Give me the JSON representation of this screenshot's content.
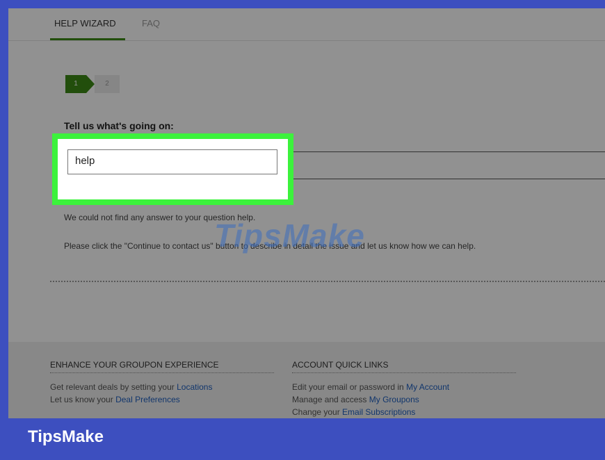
{
  "tabs": {
    "help_wizard": "HELP WIZARD",
    "faq": "FAQ"
  },
  "steps": {
    "step1": "1",
    "step2": "2"
  },
  "form": {
    "question_label": "Tell us what's going on:",
    "input_value": "help"
  },
  "messages": {
    "no_answer": "We could not find any answer to your question help.",
    "continue_prompt": "Please click the \"Continue to contact us\" button to describe in detail the issue and let us know how we can help."
  },
  "footer": {
    "enhance": {
      "heading": "ENHANCE YOUR GROUPON EXPERIENCE",
      "line1_text": "Get relevant deals by setting your ",
      "line1_link": "Locations",
      "line2_text": "Let us know your ",
      "line2_link": "Deal Preferences"
    },
    "quick_links": {
      "heading": "ACCOUNT QUICK LINKS",
      "line1_text": "Edit your email or password in ",
      "line1_link": "My Account",
      "line2_text": "Manage and access ",
      "line2_link": "My Groupons",
      "line3_text": "Change your ",
      "line3_link": "Email Subscriptions"
    }
  },
  "watermark": "TipsMake",
  "brand": "TipsMake",
  "colors": {
    "frame": "#3d4fbf",
    "highlight": "#3cf23c",
    "accent_green": "#3c8a16",
    "link_blue": "#1f5fbf"
  }
}
